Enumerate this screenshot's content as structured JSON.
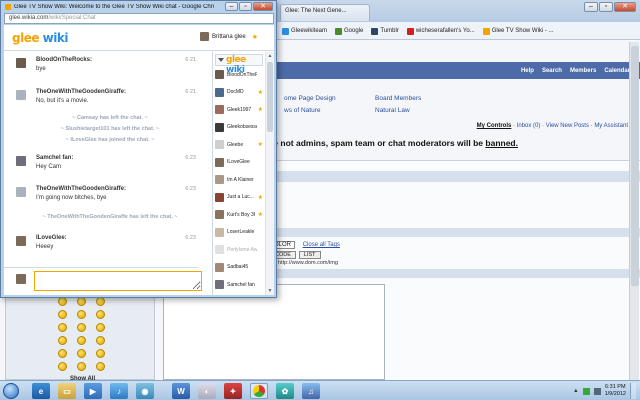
{
  "browser": {
    "tabs": [
      "Glee: The Next Gene...",
      "Gleewikiteam",
      "Google",
      "Tumblr",
      "wicheserafallen's Yo...",
      "Glee TV Show Wiki - ..."
    ],
    "wiki_nav": [
      "Help",
      "Search",
      "Members",
      "Calendar"
    ],
    "wiki_links": [
      "ome Page Design",
      "Board Members",
      "ws of Nature",
      "Natural Law"
    ],
    "user_links": [
      "My Controls",
      "Inbox (0)",
      "View New Posts",
      "My Assistant"
    ],
    "warning": "re not admins, spam team or chat moderators will be",
    "warning_bold": "banned.",
    "post_form": {
      "color_select": "OLOR",
      "close_tags": "Close all Tags",
      "buttons": [
        "CODE",
        "LIST"
      ],
      "url_hint": "http://www.dom.com/img"
    },
    "show_all": "Show All"
  },
  "chat_window": {
    "title": "Glee TV Show Wiki: Welcome to the Glee TV Show Wiki chat - Google Chrome",
    "url_host": "glee.wikia.com",
    "url_path": "/wiki/Special:Chat",
    "logo_glee": "glee",
    "logo_wiki": " wiki",
    "current_user": "Brittana glee",
    "messages": [
      {
        "name": "BloodOnTheRocks:",
        "text": "bye",
        "time": "6:21"
      },
      {
        "name": "TheOneWithTheGoodenGiraffe:",
        "text": "No, but it's a movie.",
        "time": "6:21"
      },
      {
        "name": "Samchel fan:",
        "text": "Hey Cam",
        "time": "6:23"
      },
      {
        "name": "TheOneWithTheGoodenGiraffe:",
        "text": "I'm going now bitches, bye",
        "time": "6:23"
      },
      {
        "name": "ILoveGlee:",
        "text": "Heeey",
        "time": "6:23"
      }
    ],
    "alerts": [
      "~ Camsay has left the chat. ~",
      "~ Slushietarget101 has left the chat. ~",
      "~ ILoveGlee has joined the chat. ~",
      "~ TheOneWithTheGoodenGiraffe has left the chat. ~"
    ],
    "input_value": "",
    "users": [
      {
        "name": "BloodOnTheR...",
        "star": false,
        "away": false,
        "color": "#6b5a4e"
      },
      {
        "name": "DocMD",
        "star": true,
        "away": false,
        "color": "#4a6a8c"
      },
      {
        "name": "Gleek1997",
        "star": true,
        "away": false,
        "color": "#9b6b5b"
      },
      {
        "name": "Gleekobsessed",
        "star": false,
        "away": false,
        "color": "#3a3a3a"
      },
      {
        "name": "Gleebe",
        "star": true,
        "away": false,
        "color": "#cfcfcf"
      },
      {
        "name": "ILoveGlee",
        "star": false,
        "away": false,
        "color": "#7b6a5a"
      },
      {
        "name": "Im A Klainer",
        "star": false,
        "away": false,
        "color": "#aa9988"
      },
      {
        "name": "Just a Luc...",
        "star": true,
        "away": false,
        "color": "#884433"
      },
      {
        "name": "Kurt's Boy 36",
        "star": true,
        "away": false,
        "color": "#8a7260"
      },
      {
        "name": "LoserLeakle",
        "star": false,
        "away": false,
        "color": "#c8b8a6"
      },
      {
        "name": "PerfyIsme Away",
        "star": false,
        "away": true,
        "color": "#e0e0e0"
      },
      {
        "name": "Sadbai45",
        "star": false,
        "away": false,
        "color": "#a08a76"
      },
      {
        "name": "Samchel fan",
        "star": false,
        "away": false,
        "color": "#6e6e7a"
      }
    ]
  },
  "taskbar": {
    "clock_time": "6:31 PM",
    "clock_date": "1/9/2012"
  },
  "colors": {
    "accent": "#f4a400",
    "wiki_blue": "#2a8fe0",
    "nav_bar": "#4c6ba8"
  }
}
